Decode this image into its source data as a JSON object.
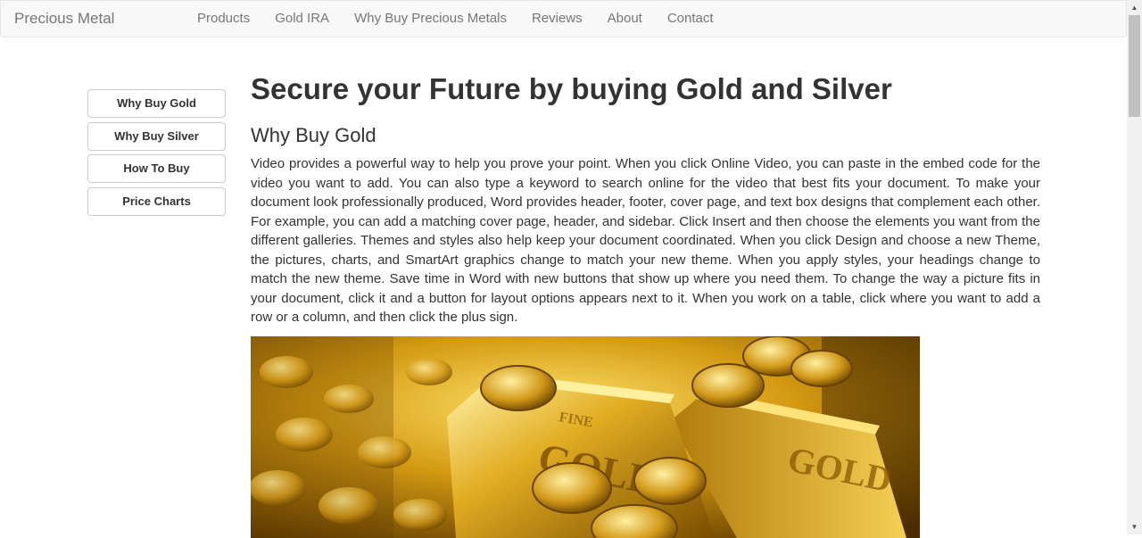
{
  "navbar": {
    "brand": "Precious Metal",
    "items": [
      {
        "label": "Products"
      },
      {
        "label": "Gold IRA"
      },
      {
        "label": "Why Buy Precious Metals"
      },
      {
        "label": "Reviews"
      },
      {
        "label": "About"
      },
      {
        "label": "Contact"
      }
    ]
  },
  "sidebar": {
    "items": [
      {
        "label": "Why Buy Gold"
      },
      {
        "label": "Why Buy Silver"
      },
      {
        "label": "How To Buy"
      },
      {
        "label": "Price Charts"
      }
    ]
  },
  "main": {
    "title": "Secure your Future by buying Gold and Silver",
    "subtitle": "Why Buy Gold",
    "paragraph": "Video provides a powerful way to help you prove your point. When you click Online Video, you can paste in the embed code for the video you want to add. You can also type a keyword to search online for the video that best fits your document. To make your document look professionally produced, Word provides header, footer, cover page, and text box designs that complement each other. For example, you can add a matching cover page, header, and sidebar. Click Insert and then choose the elements you want from the different galleries. Themes and styles also help keep your document coordinated. When you click Design and choose a new Theme, the pictures, charts, and SmartArt graphics change to match your new theme. When you apply styles, your headings change to match the new theme. Save time in Word with new buttons that show up where you need them. To change the way a picture fits in your document, click it and a button for layout options appears next to it. When you work on a table, click where you want to add a row or a column, and then click the plus sign.",
    "image": {
      "bar_text": "GOLD",
      "bar_subtext": "FINE"
    }
  },
  "colors": {
    "navbar_bg": "#f8f8f8",
    "nav_text": "#777777",
    "body_text": "#333333",
    "gold_light": "#ffe36b",
    "gold_dark": "#6a4300"
  },
  "icons": {
    "scroll_up": "triangle-up-icon",
    "scroll_down": "triangle-down-icon"
  }
}
